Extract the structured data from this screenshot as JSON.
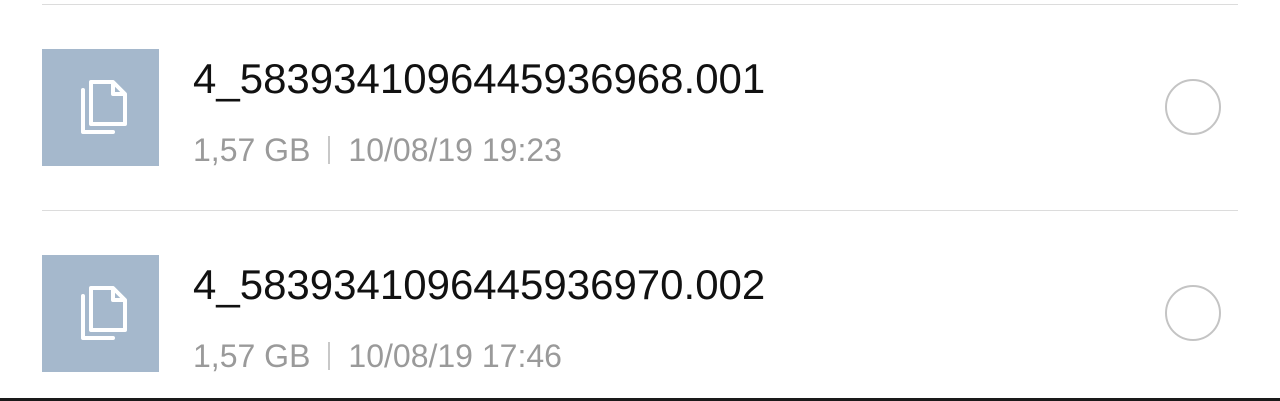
{
  "files": [
    {
      "icon": "copy-file-icon",
      "name": "4_5839341096445936968.001",
      "size": "1,57 GB",
      "datetime": "10/08/19 19:23",
      "selected": false
    },
    {
      "icon": "copy-file-icon",
      "name": "4_5839341096445936970.002",
      "size": "1,57 GB",
      "datetime": "10/08/19 17:46",
      "selected": false
    }
  ],
  "colors": {
    "thumb_background": "#a5b8cc",
    "name_text": "#111111",
    "meta_text": "#9a9a9a",
    "divider": "#dcdcdc",
    "radio_border": "#c4c4c4"
  }
}
